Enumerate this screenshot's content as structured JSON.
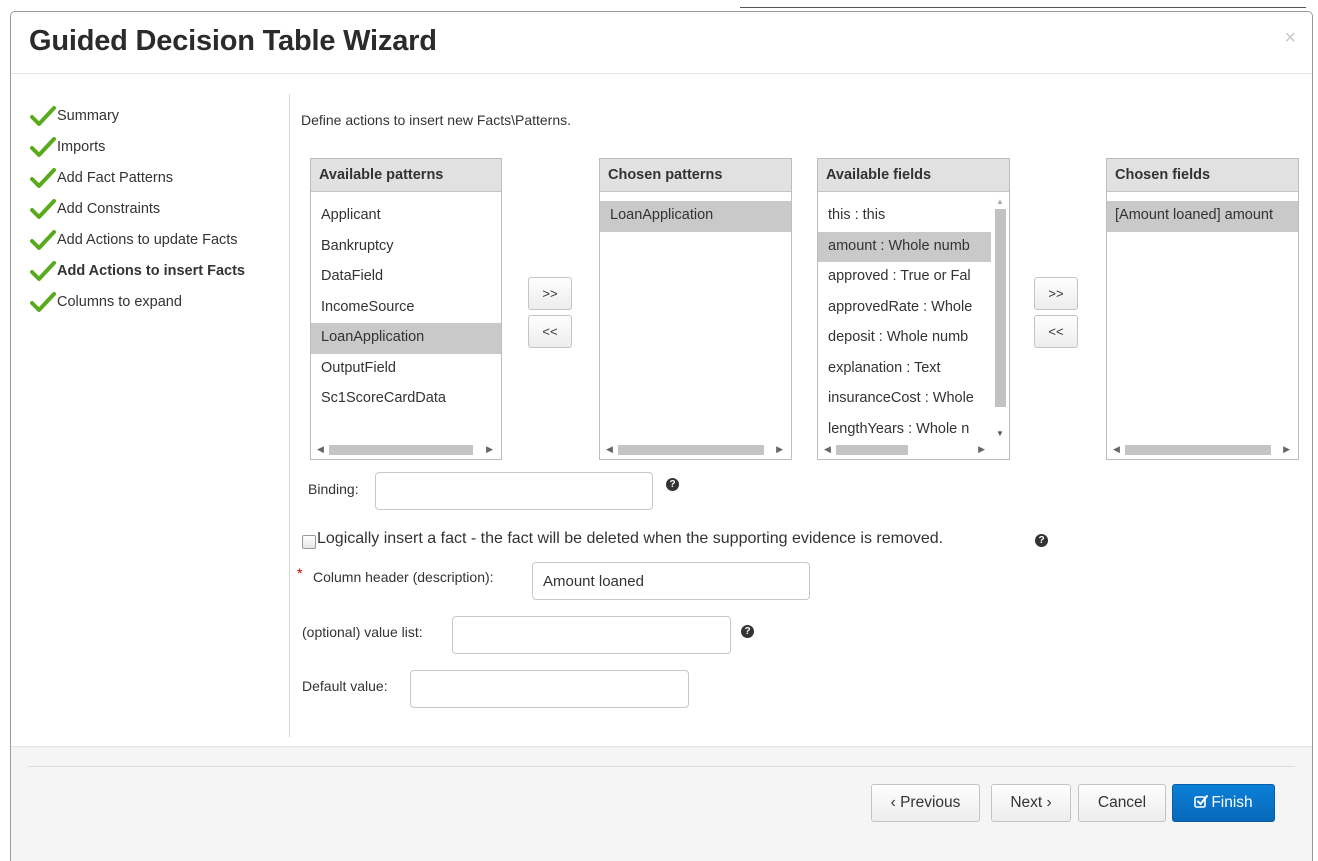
{
  "dialog": {
    "title": "Guided Decision Table Wizard",
    "close": "×"
  },
  "steps": [
    {
      "label": "Summary"
    },
    {
      "label": "Imports"
    },
    {
      "label": "Add Fact Patterns"
    },
    {
      "label": "Add Constraints"
    },
    {
      "label": "Add Actions to update Facts"
    },
    {
      "label": "Add Actions to insert Facts"
    },
    {
      "label": "Columns to expand"
    }
  ],
  "instruction": "Define actions to insert new Facts\\Patterns.",
  "available_patterns": {
    "header": "Available patterns",
    "items": [
      "Applicant",
      "Bankruptcy",
      "DataField",
      "IncomeSource",
      "LoanApplication",
      "OutputField",
      "Sc1ScoreCardData"
    ]
  },
  "chosen_patterns": {
    "header": "Chosen patterns",
    "items": [
      "LoanApplication"
    ]
  },
  "available_fields": {
    "header": "Available fields",
    "items": [
      "this : this",
      "amount : Whole numb",
      "approved : True or Fal",
      "approvedRate : Whole",
      "deposit : Whole numb",
      "explanation : Text",
      "insuranceCost : Whole",
      "lengthYears : Whole n"
    ]
  },
  "chosen_fields": {
    "header": "Chosen fields",
    "items": [
      "[Amount loaned] amount"
    ]
  },
  "move_buttons": {
    "add": ">>",
    "remove": "<<"
  },
  "form": {
    "binding_label": "Binding:",
    "binding_value": "",
    "logical_insert_label": "Logically insert a fact - the fact will be deleted when the supporting evidence is removed.",
    "required_mark": "*",
    "column_header_label": "Column header (description):",
    "column_header_value": "Amount loaned",
    "value_list_label": "(optional) value list:",
    "value_list_value": "",
    "default_value_label": "Default value:",
    "default_value_value": "",
    "help_glyph": "?"
  },
  "footer": {
    "previous": "‹ Previous",
    "next": "Next ›",
    "cancel": "Cancel",
    "finish": "Finish",
    "finish_icon": "checkbox-edit-icon"
  },
  "colors": {
    "primary": "#0868b8",
    "selected": "#c9c9c9",
    "check": "#5aaa1e",
    "header_bg": "#e1e1e1",
    "footer_bg": "#f5f5f5"
  }
}
